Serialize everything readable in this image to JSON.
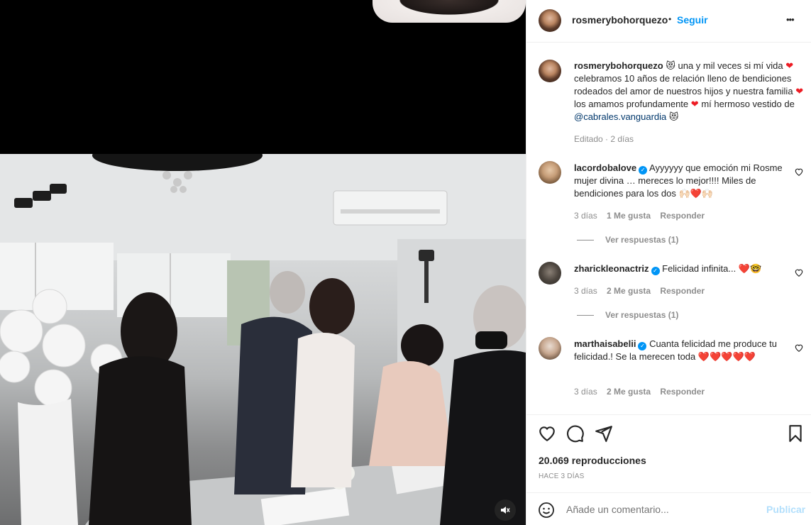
{
  "post": {
    "author": "rosmerybohorquezo",
    "follow_label": "Seguir",
    "dot": "•",
    "more_label": "•••"
  },
  "caption": {
    "author": "rosmerybohorquezo",
    "emoji_start": "😻",
    "text_1": "una y mil veces si mí vida",
    "text_2": "celebramos 10 años de relación lleno de bendiciones rodeados del amor de nuestros hijos y nuestra familia",
    "text_3": "los amamos profundamente",
    "text_4": "mí hermoso vestido de",
    "mention": "@cabrales.vanguardia",
    "emoji_end": "😻",
    "meta": "Editado · 2 días"
  },
  "comments": [
    {
      "username": "lacordobalove",
      "verified": true,
      "text": "Ayyyyyy que emoción mi Rosme mujer divina … mereces lo mejor!!!! Miles de bendiciones para los dos",
      "emojis": "🙌🏻❤️🙌🏻",
      "time": "3 días",
      "likes": "1 Me gusta",
      "reply_label": "Responder",
      "view_replies": "Ver respuestas (1)"
    },
    {
      "username": "zharickleonactriz",
      "verified": true,
      "text": "Felicidad infinita...",
      "emojis": "❤️🤓",
      "time": "3 días",
      "likes": "2 Me gusta",
      "reply_label": "Responder",
      "view_replies": "Ver respuestas (1)"
    },
    {
      "username": "marthaisabelii",
      "verified": true,
      "text": "Cuanta felicidad me produce tu felicidad.! Se la merecen toda",
      "emojis": "❤️❤️❤️❤️❤️",
      "time": "3 días",
      "likes": "2 Me gusta",
      "reply_label": "Responder"
    }
  ],
  "stats": {
    "views": "20.069 reproducciones",
    "date": "HACE 3 DÍAS"
  },
  "add_comment": {
    "placeholder": "Añade un comentario...",
    "publish_label": "Publicar"
  },
  "colors": {
    "accent": "#0095f6",
    "heart": "#ed1c24",
    "muted": "#8e8e8e"
  }
}
